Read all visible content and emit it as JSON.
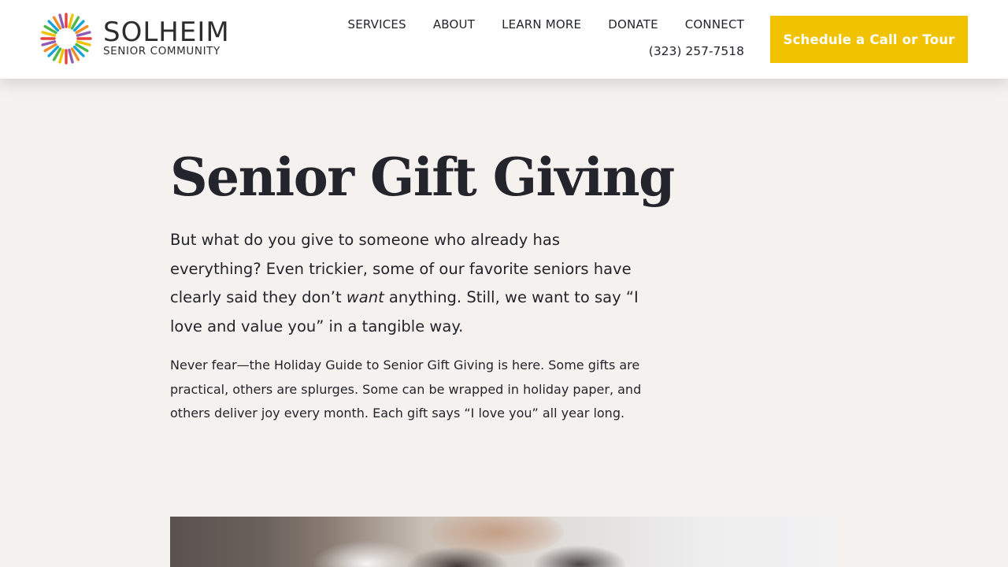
{
  "brand": {
    "name": "SOLHEIM",
    "tagline": "SENIOR COMMUNITY",
    "logo_icon": "sunburst-icon",
    "logo_colors": [
      "#e8423f",
      "#f0c200",
      "#4cb848",
      "#1aa3d8",
      "#f28c28",
      "#8e5bb5"
    ]
  },
  "nav": {
    "items": [
      {
        "label": "SERVICES"
      },
      {
        "label": "ABOUT"
      },
      {
        "label": "LEARN MORE"
      },
      {
        "label": "DONATE"
      },
      {
        "label": "CONNECT"
      }
    ],
    "phone": "(323) 257-7518",
    "cta_label": "Schedule a Call or Tour"
  },
  "article": {
    "title": "Senior Gift Giving",
    "lead_before": "But what do you give to someone who already has everything? Even trickier, some of our favorite seniors have clearly said they don’t ",
    "lead_em": "want",
    "lead_after": " anything. Still, we want to say “I love and value you” in a tangible way.",
    "body": "Never fear—the Holiday Guide to Senior Gift Giving is here. Some gifts are practical, others are splurges. Some can be wrapped in holiday paper, and others deliver joy every month. Each gift says “I love you” all year long."
  },
  "colors": {
    "accent": "#f0c200",
    "background": "#f5f1ee",
    "text": "#23242c"
  }
}
